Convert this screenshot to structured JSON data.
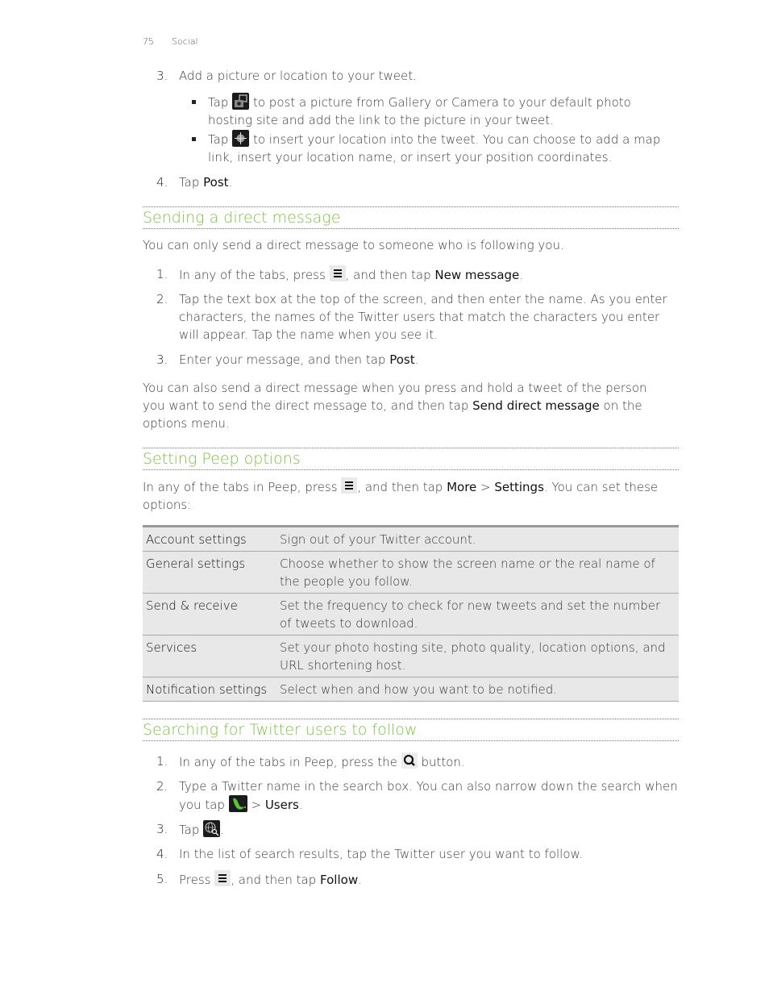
{
  "header": {
    "page_number": "75",
    "chapter": "Social"
  },
  "intro_steps": [
    {
      "num": "3.",
      "text": "Add a picture or location to your tweet."
    },
    {
      "num": "4.",
      "pre": "Tap ",
      "bold": "Post",
      "post": "."
    }
  ],
  "bullets": [
    {
      "pre": "Tap",
      "icon": "camera-gallery-icon",
      "text": "to post a picture from Gallery or Camera to your default photo hosting site and add the link to the picture in your tweet."
    },
    {
      "pre": "Tap",
      "icon": "location-target-icon",
      "text": "to insert your location into the tweet. You can choose to add a map link, insert your location name, or insert your position coordinates."
    }
  ],
  "sections": {
    "direct": {
      "title": "Sending a direct message",
      "intro": "You can only send a direct message to someone who is following you.",
      "steps": [
        {
          "num": "1.",
          "pre": "In any of the tabs, press ",
          "icon": "menu-icon",
          "mid": ", and then tap ",
          "bold": "New message",
          "post": "."
        },
        {
          "num": "2.",
          "text": "Tap the text box at the top of the screen, and then enter the name. As you enter characters, the names of the Twitter users that match the characters you enter will appear. Tap the name when you see it."
        },
        {
          "num": "3.",
          "pre": "Enter your message, and then tap ",
          "bold": "Post",
          "post": "."
        }
      ],
      "outro_pre": "You can also send a direct message when you press and hold a tweet of the person you want to send the direct message to, and then tap ",
      "outro_bold": "Send direct message",
      "outro_post": " on the options menu."
    },
    "options": {
      "title": "Setting Peep options",
      "intro_pre": "In any of the tabs in Peep, press ",
      "intro_mid": ", and then tap ",
      "intro_bold1": "More",
      "intro_sep": " > ",
      "intro_bold2": "Settings",
      "intro_post": ". You can set these options:",
      "table": [
        {
          "setting": "Account settings",
          "desc": "Sign out of your Twitter account."
        },
        {
          "setting": "General settings",
          "desc": "Choose whether to show the screen name or the real name of the people you follow."
        },
        {
          "setting": "Send & receive",
          "desc": "Set the frequency to check for new tweets and set the number of tweets to download."
        },
        {
          "setting": "Services",
          "desc": "Set your photo hosting site, photo quality, location options, and URL shortening host."
        },
        {
          "setting": "Notification settings",
          "desc": "Select when and how you want to be notified."
        }
      ]
    },
    "search": {
      "title": "Searching for Twitter users to follow",
      "steps": [
        {
          "num": "1.",
          "pre": "In any of the tabs in Peep, press the ",
          "post": " button."
        },
        {
          "num": "2.",
          "pre": "Type a Twitter name in the search box. You can also narrow down the search when you tap ",
          "sep": " > ",
          "bold": "Users",
          "post": "."
        },
        {
          "num": "3.",
          "pre": "Tap ",
          "post": "."
        },
        {
          "num": "4.",
          "text": "In the list of search results, tap the Twitter user you want to follow."
        },
        {
          "num": "5.",
          "pre": "Press ",
          "mid": ", and then tap ",
          "bold": "Follow",
          "post": "."
        }
      ]
    }
  },
  "colors": {
    "heading": "#7cc142",
    "table_bg": "#e8e8e8"
  }
}
